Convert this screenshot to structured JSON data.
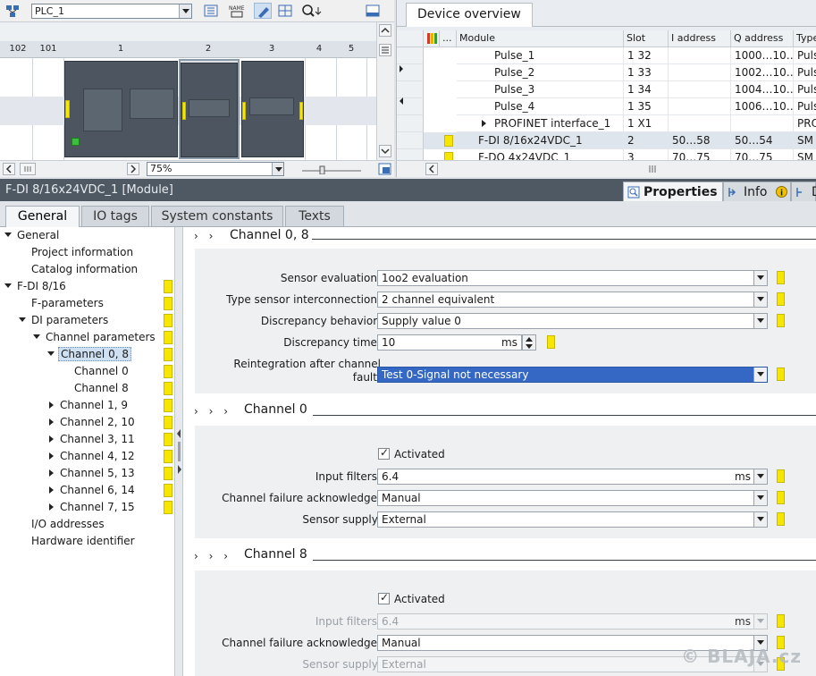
{
  "device_view": {
    "plc_select": "PLC_1",
    "zoom_select": "75%",
    "slot_labels": [
      "102",
      "101",
      "1",
      "2",
      "3",
      "4",
      "5"
    ]
  },
  "device_overview": {
    "tab_label": "Device overview",
    "columns": [
      "...",
      "Module",
      "Slot",
      "I address",
      "Q address",
      "Type"
    ],
    "rows": [
      {
        "module": "Pulse_1",
        "slot": "1 32",
        "i_address": "",
        "q_address": "1000…10…",
        "type": "Puls"
      },
      {
        "module": "Pulse_2",
        "slot": "1 33",
        "i_address": "",
        "q_address": "1002…10…",
        "type": "Puls"
      },
      {
        "module": "Pulse_3",
        "slot": "1 34",
        "i_address": "",
        "q_address": "1004…10…",
        "type": "Puls"
      },
      {
        "module": "Pulse_4",
        "slot": "1 35",
        "i_address": "",
        "q_address": "1006…10…",
        "type": "Puls"
      },
      {
        "module": "PROFINET interface_1",
        "slot": "1 X1",
        "i_address": "",
        "q_address": "",
        "type": "PRO"
      },
      {
        "module": "F-DI 8/16x24VDC_1",
        "slot": "2",
        "i_address": "50…58",
        "q_address": "50…54",
        "type": "SM"
      },
      {
        "module": "F-DQ 4x24VDC_1",
        "slot": "3",
        "i_address": "70…75",
        "q_address": "70…75",
        "type": "SM"
      }
    ]
  },
  "properties": {
    "title": "F-DI 8/16x24VDC_1 [Module]",
    "tabs": {
      "properties": "Properties",
      "info": "Info",
      "diagnostics": "D"
    },
    "subtabs": [
      "General",
      "IO tags",
      "System constants",
      "Texts"
    ]
  },
  "tree": [
    "General",
    "Project information",
    "Catalog information",
    "F-DI 8/16",
    "F-parameters",
    "DI parameters",
    "Channel parameters",
    "Channel 0, 8",
    "Channel 0",
    "Channel 8",
    "Channel 1, 9",
    "Channel 2, 10",
    "Channel 3, 11",
    "Channel 4, 12",
    "Channel 5, 13",
    "Channel 6, 14",
    "Channel 7, 15",
    "I/O addresses",
    "Hardware identifier"
  ],
  "section_ch08": {
    "title": "Channel 0, 8",
    "sensor_evaluation_label": "Sensor evaluation:",
    "sensor_evaluation": "1oo2 evaluation",
    "type_sensor_label": "Type sensor interconnection:",
    "type_sensor": "2 channel equivalent",
    "discrepancy_behavior_label": "Discrepancy behavior:",
    "discrepancy_behavior": "Supply value 0",
    "discrepancy_time_label": "Discrepancy time:",
    "discrepancy_time": "10",
    "discrepancy_time_unit": "ms",
    "reintegration_label_1": "Reintegration after channel",
    "reintegration_label_2": "fault:",
    "reintegration": "Test 0-Signal not necessary"
  },
  "section_ch0": {
    "title": "Channel 0",
    "activated_label": "Activated",
    "input_filters_label": "Input filters:",
    "input_filters": "6.4",
    "input_filters_unit": "ms",
    "channel_failure_label": "Channel failure acknowledge:",
    "channel_failure": "Manual",
    "sensor_supply_label": "Sensor supply:",
    "sensor_supply": "External"
  },
  "section_ch8": {
    "title": "Channel 8",
    "activated_label": "Activated",
    "input_filters_label": "Input filters:",
    "input_filters": "6.4",
    "input_filters_unit": "ms",
    "channel_failure_label": "Channel failure acknowledge:",
    "channel_failure": "Manual",
    "sensor_supply_label": "Sensor supply:",
    "sensor_supply": "External"
  },
  "watermark": "© BLAJA.cz"
}
